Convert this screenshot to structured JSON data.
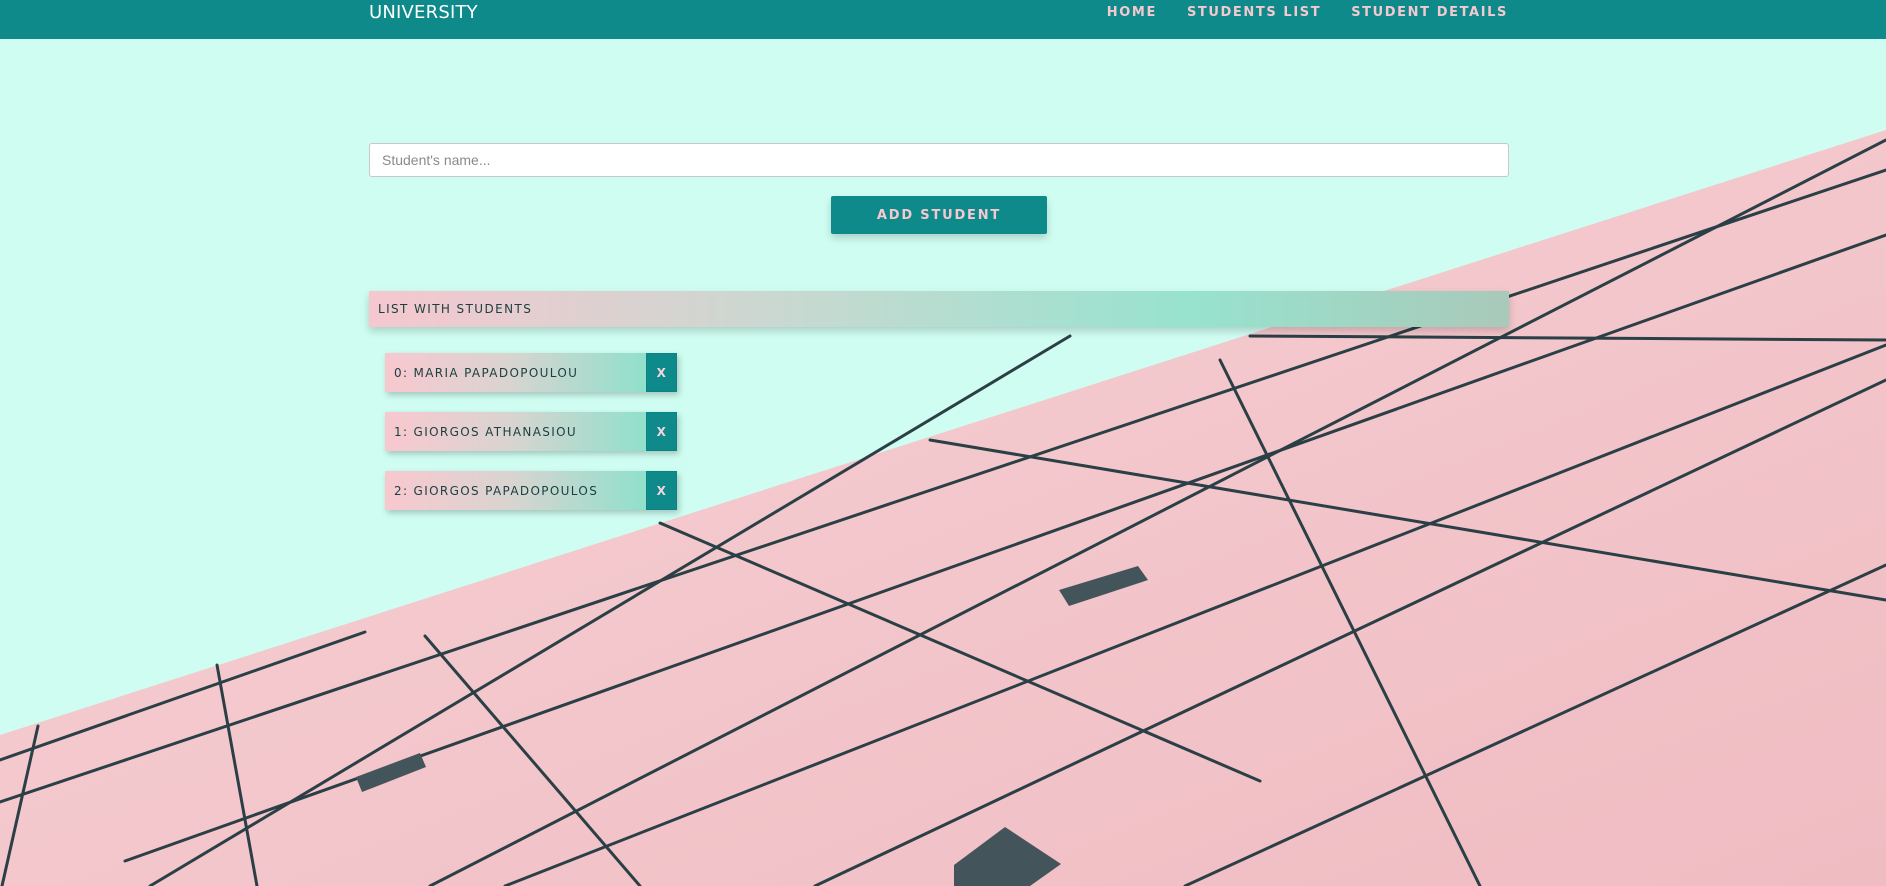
{
  "brand": {
    "name": "UNIVERSITY"
  },
  "nav": {
    "items": [
      {
        "label": "HOME"
      },
      {
        "label": "STUDENTS LIST"
      },
      {
        "label": "STUDENT DETAILS"
      }
    ]
  },
  "form": {
    "input_value": "",
    "input_placeholder": "Student's name...",
    "add_button_label": "ADD STUDENT"
  },
  "list": {
    "title": "LIST WITH STUDENTS",
    "items": [
      {
        "label": "0: MARIA PAPADOPOULOU",
        "delete_label": "X"
      },
      {
        "label": "1: GIORGOS ATHANASIOU",
        "delete_label": "X"
      },
      {
        "label": "2: GIORGOS PAPADOPOULOS",
        "delete_label": "X"
      }
    ]
  },
  "colors": {
    "accent": "#0e8a8a",
    "page_background": "#cffdf1",
    "pink": "#f6c7cf",
    "mint": "#97e3ce"
  },
  "icons": {
    "delete": "close-x"
  }
}
